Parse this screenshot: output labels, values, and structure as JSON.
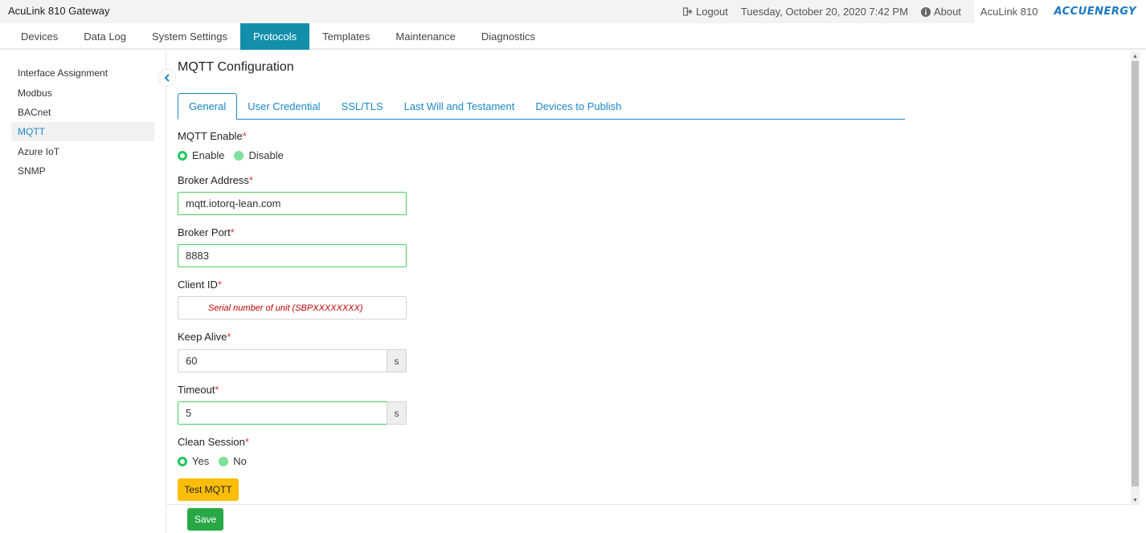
{
  "app": {
    "title": "AcuLink 810 Gateway"
  },
  "topbar": {
    "logout": "Logout",
    "datetime": "Tuesday, October 20, 2020 7:42 PM",
    "about": "About",
    "product": "AcuLink 810",
    "logo": "ACCUENERGY"
  },
  "nav": {
    "items": [
      "Devices",
      "Data Log",
      "System Settings",
      "Protocols",
      "Templates",
      "Maintenance",
      "Diagnostics"
    ],
    "active": "Protocols"
  },
  "sidebar": {
    "items": [
      "Interface Assignment",
      "Modbus",
      "BACnet",
      "MQTT",
      "Azure IoT",
      "SNMP"
    ],
    "active": "MQTT"
  },
  "main": {
    "title": "MQTT Configuration",
    "tabs": [
      "General",
      "User Credential",
      "SSL/TLS",
      "Last Will and Testament",
      "Devices to Publish"
    ],
    "active_tab": "General",
    "mqtt_enable": {
      "label": "MQTT Enable",
      "required": "*",
      "options": [
        "Enable",
        "Disable"
      ],
      "selected": "Enable"
    },
    "broker_address": {
      "label": "Broker Address",
      "required": "*",
      "value": "mqtt.iotorq-lean.com"
    },
    "broker_port": {
      "label": "Broker Port",
      "required": "*",
      "value": "8883"
    },
    "client_id": {
      "label": "Client ID",
      "required": "*",
      "value": "",
      "note": "Serial number of unit (SBPXXXXXXXX)"
    },
    "keep_alive": {
      "label": "Keep Alive",
      "required": "*",
      "value": "60",
      "unit": "s"
    },
    "timeout": {
      "label": "Timeout",
      "required": "*",
      "value": "5",
      "unit": "s"
    },
    "clean_session": {
      "label": "Clean Session",
      "required": "*",
      "options": [
        "Yes",
        "No"
      ],
      "selected": "Yes"
    },
    "test_button": "Test MQTT",
    "save_button": "Save"
  },
  "colors": {
    "nav_active": "#138fab",
    "link": "#1a88c8",
    "valid_border": "#4cd263",
    "radio_on": "#22c55e",
    "test_button": "#fbbd08",
    "save_button": "#28a745",
    "required": "#d9363e"
  },
  "icons": {
    "logout": "sign-out-icon",
    "about": "info-circle-icon",
    "collapse": "chevron-left-icon"
  }
}
